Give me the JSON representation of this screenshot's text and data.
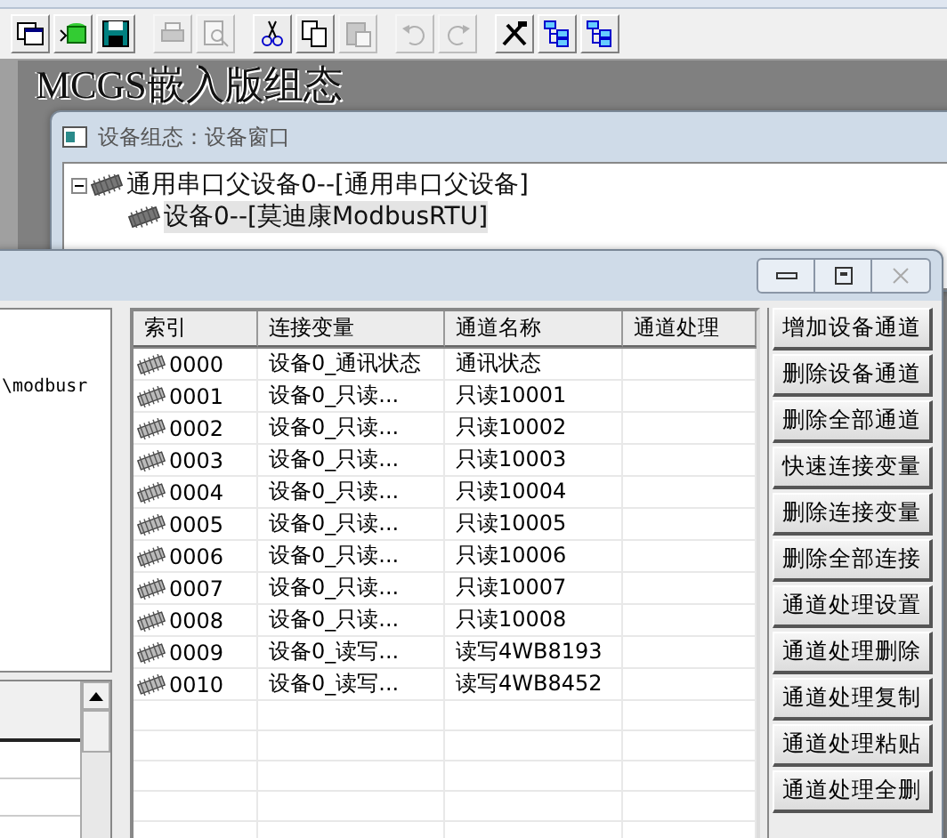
{
  "toolbar": [
    {
      "kind": "windows",
      "disabled": false
    },
    {
      "kind": "database",
      "disabled": false
    },
    {
      "kind": "save",
      "disabled": false
    },
    {
      "kind": "print",
      "disabled": true
    },
    {
      "kind": "preview",
      "disabled": true
    },
    {
      "kind": "cut",
      "disabled": false
    },
    {
      "kind": "copy",
      "disabled": false
    },
    {
      "kind": "paste",
      "disabled": true
    },
    {
      "kind": "undo",
      "disabled": true
    },
    {
      "kind": "redo",
      "disabled": true
    },
    {
      "kind": "tools",
      "disabled": false
    },
    {
      "kind": "tree",
      "disabled": false
    },
    {
      "kind": "tree",
      "disabled": false
    }
  ],
  "banner": "MCGS嵌入版组态",
  "device_window": {
    "title": "设备组态：设备窗口",
    "tree": [
      {
        "label": "通用串口父设备0--[通用串口父设备]",
        "expanded": true,
        "selected": false,
        "children": [
          {
            "label": "设备0--[莫迪康ModbusRTU]",
            "selected": true
          }
        ]
      }
    ]
  },
  "editor_window": {
    "left_panel_text": "\\modbusr",
    "table": {
      "columns": [
        "索引",
        "连接变量",
        "通道名称",
        "通道处理"
      ],
      "rows": [
        {
          "index": "0000",
          "variable": "设备0_通讯状态",
          "channel": "通讯状态"
        },
        {
          "index": "0001",
          "variable": "设备0_只读...",
          "channel": "只读10001"
        },
        {
          "index": "0002",
          "variable": "设备0_只读...",
          "channel": "只读10002"
        },
        {
          "index": "0003",
          "variable": "设备0_只读...",
          "channel": "只读10003"
        },
        {
          "index": "0004",
          "variable": "设备0_只读...",
          "channel": "只读10004"
        },
        {
          "index": "0005",
          "variable": "设备0_只读...",
          "channel": "只读10005"
        },
        {
          "index": "0006",
          "variable": "设备0_只读...",
          "channel": "只读10006"
        },
        {
          "index": "0007",
          "variable": "设备0_只读...",
          "channel": "只读10007"
        },
        {
          "index": "0008",
          "variable": "设备0_只读...",
          "channel": "只读10008"
        },
        {
          "index": "0009",
          "variable": "设备0_读写...",
          "channel": "读写4WB8193"
        },
        {
          "index": "0010",
          "variable": "设备0_读写...",
          "channel": "读写4WB8452"
        }
      ]
    },
    "buttons": [
      "增加设备通道",
      "删除设备通道",
      "删除全部通道",
      "快速连接变量",
      "删除连接变量",
      "删除全部连接",
      "通道处理设置",
      "通道处理删除",
      "通道处理复制",
      "通道处理粘贴",
      "通道处理全删"
    ]
  }
}
